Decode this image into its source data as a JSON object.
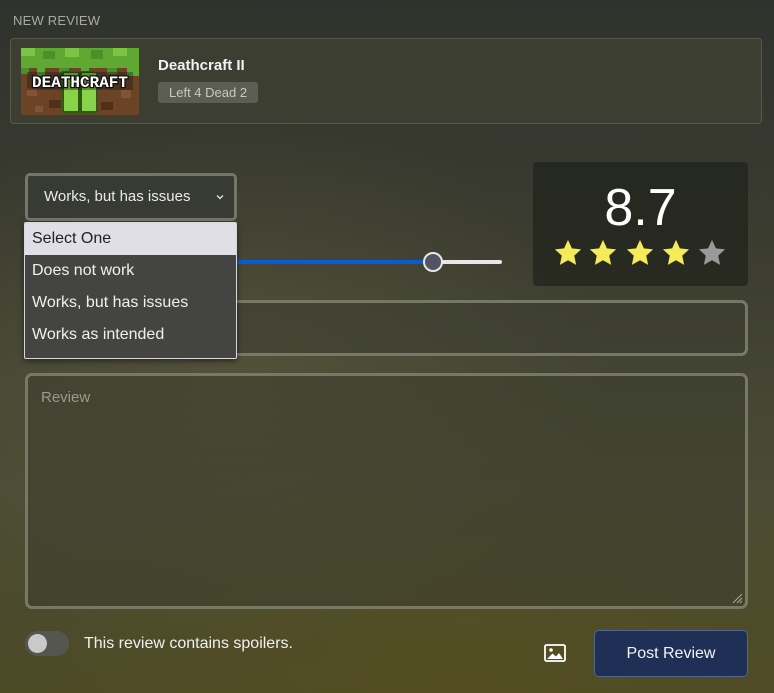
{
  "header": {
    "label": "NEW REVIEW"
  },
  "game": {
    "title": "Deathcraft II",
    "parent": "Left 4 Dead 2",
    "thumbnail_icon": "deathcraft-logo-image"
  },
  "status_select": {
    "value": "Works, but has issues",
    "options": [
      "Select One",
      "Does not work",
      "Works, but has issues",
      "Works as intended"
    ],
    "highlighted_option": "Select One"
  },
  "rating_slider": {
    "value": 8.7,
    "min": 0,
    "max": 10
  },
  "score": {
    "value": "8.7",
    "stars": 4,
    "max_stars": 5,
    "filled_color": "#f5ea58",
    "empty_color": "#9a9a9a"
  },
  "title_field": {
    "placeholder": ""
  },
  "review_field": {
    "placeholder": "Review"
  },
  "spoiler_toggle": {
    "label": "This review contains spoilers.",
    "on": false
  },
  "actions": {
    "image_icon": "image-icon",
    "post_label": "Post Review"
  },
  "colors": {
    "accent": "#0a5bd8",
    "button_bg": "#1f2f55"
  }
}
